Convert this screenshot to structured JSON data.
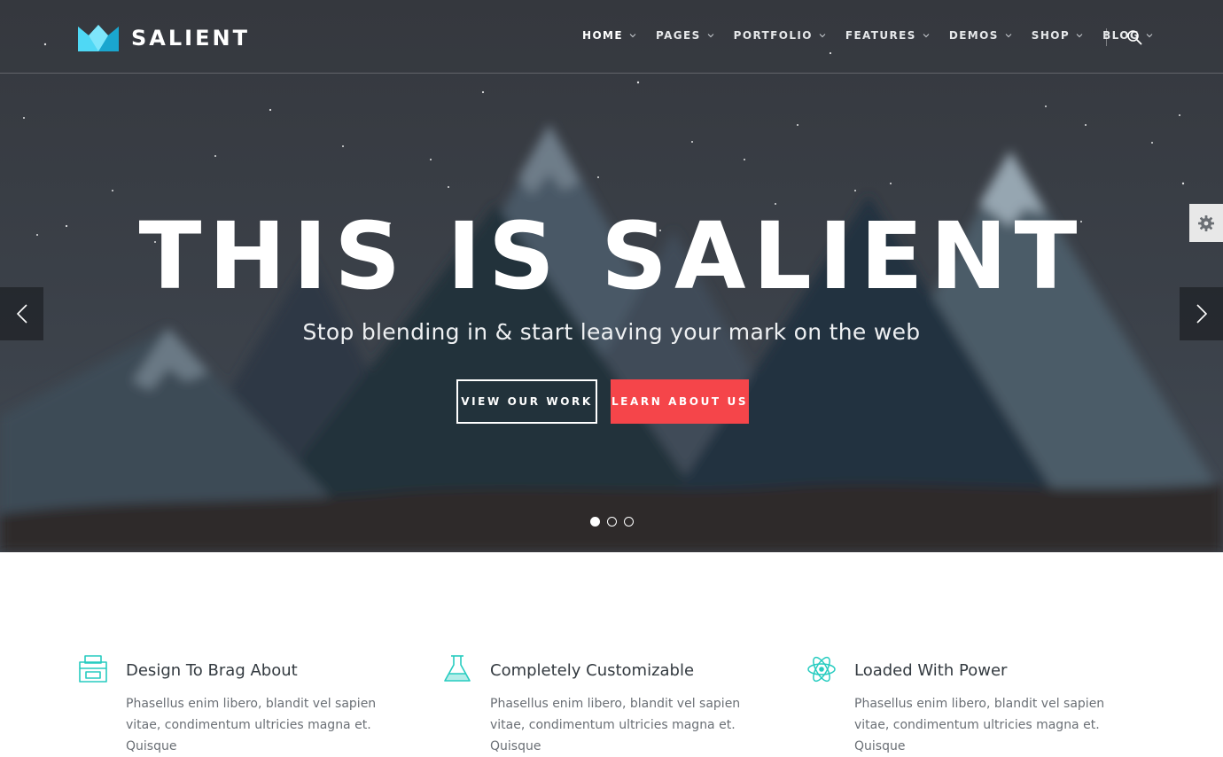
{
  "brand": {
    "name": "SALIENT"
  },
  "nav": {
    "items": [
      {
        "label": "HOME"
      },
      {
        "label": "PAGES"
      },
      {
        "label": "PORTFOLIO"
      },
      {
        "label": "FEATURES"
      },
      {
        "label": "DEMOS"
      },
      {
        "label": "SHOP"
      },
      {
        "label": "BLOG"
      }
    ],
    "active_index": 0
  },
  "hero": {
    "title": "THIS IS SALIENT",
    "subtitle": "Stop blending in & start leaving your mark on the web",
    "primary_button": "VIEW OUR WORK",
    "secondary_button": "LEARN ABOUT US",
    "slide_count": 3,
    "active_slide": 1
  },
  "features": [
    {
      "icon": "printer-icon",
      "title": "Design To Brag About",
      "body": "Phasellus enim libero, blandit vel sapien vitae, condimentum ultricies magna et. Quisque"
    },
    {
      "icon": "flask-icon",
      "title": "Completely Customizable",
      "body": "Phasellus enim libero, blandit vel sapien vitae, condimentum ultricies magna et. Quisque"
    },
    {
      "icon": "atom-icon",
      "title": "Loaded With Power",
      "body": "Phasellus enim libero, blandit vel sapien vitae, condimentum ultricies magna et. Quisque"
    }
  ],
  "colors": {
    "accent": "#27ccc0",
    "cta": "#f5454a",
    "logo": "#2ac4ea"
  }
}
